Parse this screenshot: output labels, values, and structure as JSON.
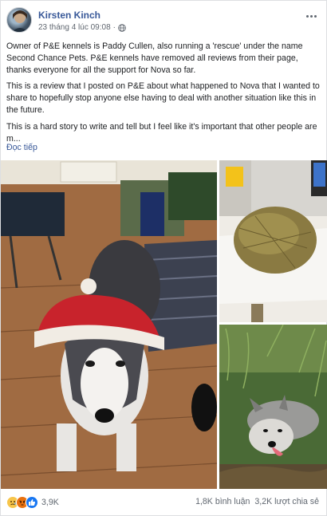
{
  "post": {
    "author": "Kirsten Kinch",
    "timestamp": "23 tháng 4 lúc 09:08",
    "privacy_icon": "globe-icon",
    "paragraphs": [
      "Owner of P&E kennels is Paddy Cullen, also running a 'rescue' under the name Second Chance Pets. P&E kennels have removed all reviews from their page, thanks everyone for all the support for Nova so far.",
      "This is a review that I posted on P&E about what happened to Nova that I wanted to share to hopefully stop anyone else having to deal with another situation like this in the future.",
      "This is a hard story to write and tell but I feel like it's important that other people are m..."
    ],
    "see_more": "Đọc tiếp"
  },
  "footer": {
    "reactions": [
      "sad",
      "angry",
      "like"
    ],
    "reaction_count": "3,9K",
    "comments": "1,8K bình luận",
    "shares": "3,2K lượt chia sẻ"
  },
  "colors": {
    "link": "#385898",
    "secondary_text": "#606770",
    "like_blue": "#1877f2"
  }
}
